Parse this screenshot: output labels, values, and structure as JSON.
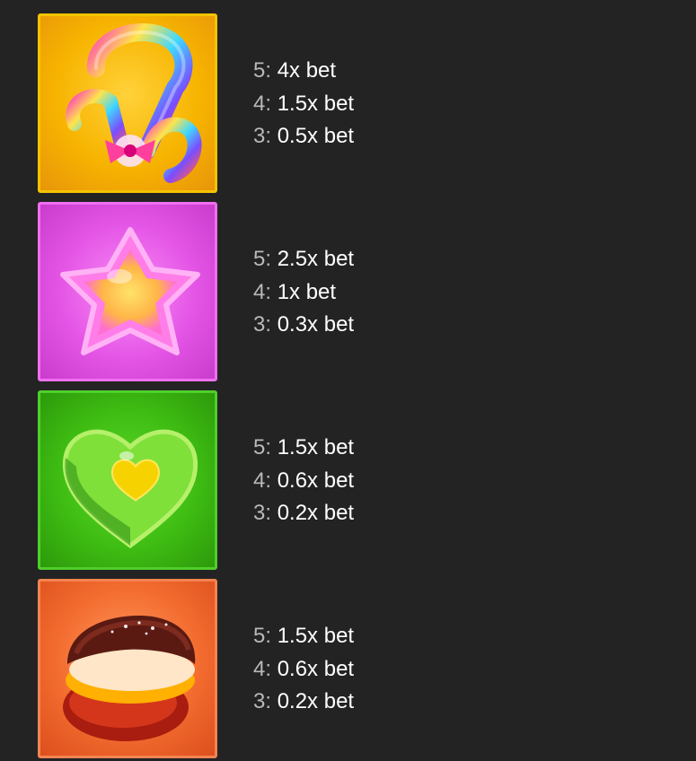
{
  "paytable": {
    "symbols": [
      {
        "icon": "candy-cane-symbol-icon",
        "tile_color": "#f6b000",
        "pays": [
          {
            "count": "5:",
            "value": "4x bet"
          },
          {
            "count": "4:",
            "value": "1.5x bet"
          },
          {
            "count": "3:",
            "value": "0.5x bet"
          }
        ]
      },
      {
        "icon": "pink-star-jelly-symbol-icon",
        "tile_color": "#e24ee6",
        "pays": [
          {
            "count": "5:",
            "value": "2.5x bet"
          },
          {
            "count": "4:",
            "value": "1x bet"
          },
          {
            "count": "3:",
            "value": "0.3x bet"
          }
        ]
      },
      {
        "icon": "green-heart-jelly-symbol-icon",
        "tile_color": "#3fbd13",
        "pays": [
          {
            "count": "5:",
            "value": "1.5x bet"
          },
          {
            "count": "4:",
            "value": "0.6x bet"
          },
          {
            "count": "3:",
            "value": "0.2x bet"
          }
        ]
      },
      {
        "icon": "macaron-symbol-icon",
        "tile_color": "#f06a30",
        "pays": [
          {
            "count": "5:",
            "value": "1.5x bet"
          },
          {
            "count": "4:",
            "value": "0.6x bet"
          },
          {
            "count": "3:",
            "value": "0.2x bet"
          }
        ]
      }
    ]
  }
}
